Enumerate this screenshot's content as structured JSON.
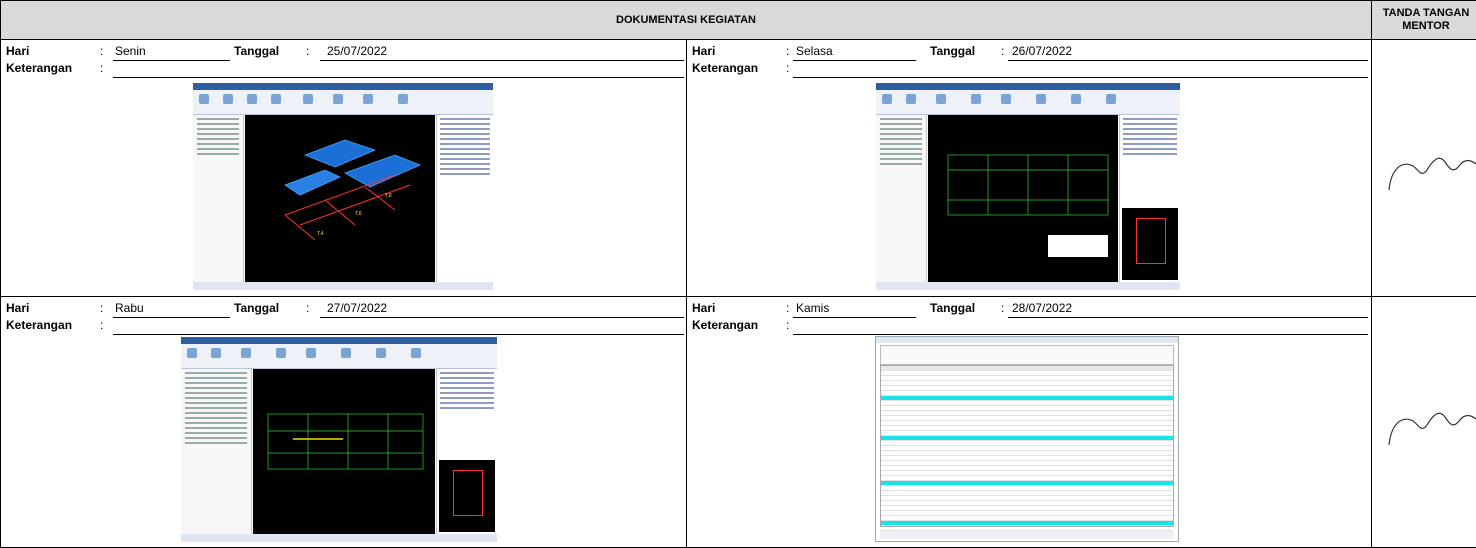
{
  "header": {
    "title": "DOKUMENTASI KEGIATAN",
    "sign_label": "TANDA TANGAN MENTOR"
  },
  "labels": {
    "day": "Hari",
    "date": "Tanggal",
    "note": "Keterangan",
    "colon": ":"
  },
  "entries": [
    {
      "day": "Senin",
      "date": "25/07/2022",
      "note": "",
      "screenshot": "cad-3d-model"
    },
    {
      "day": "Selasa",
      "date": "26/07/2022",
      "note": "",
      "screenshot": "cad-beam-plan"
    },
    {
      "day": "Rabu",
      "date": "27/07/2022",
      "note": "",
      "screenshot": "cad-beam-plan"
    },
    {
      "day": "Kamis",
      "date": "28/07/2022",
      "note": "",
      "screenshot": "beam-schedule-table"
    }
  ],
  "colors": {
    "header_bg": "#d9d9d9",
    "cad_bg": "#000000",
    "highlight_row": "#19e3e8"
  }
}
